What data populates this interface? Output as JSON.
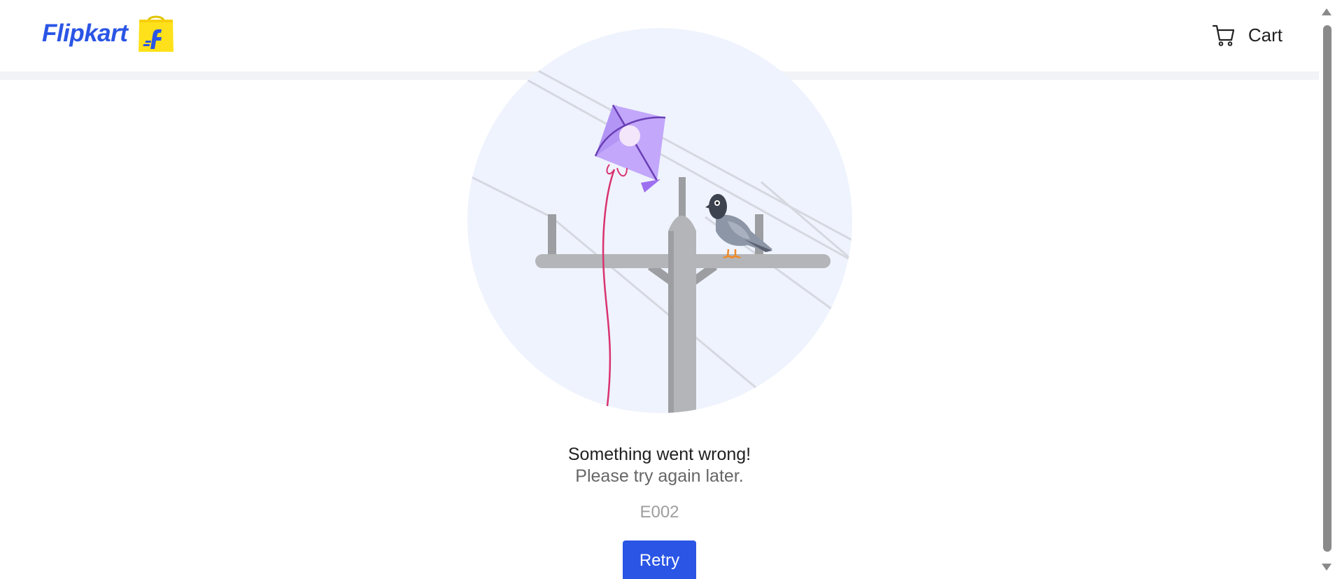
{
  "header": {
    "logo_text": "Flipkart",
    "cart_label": "Cart"
  },
  "icons": {
    "logo": "flipkart-bag-icon",
    "cart": "shopping-cart-icon"
  },
  "error": {
    "title": "Something went wrong!",
    "subtitle": "Please try again later.",
    "code": "E002",
    "retry_label": "Retry"
  },
  "colors": {
    "brand_blue": "#2a55e5",
    "logo_yellow": "#ffe11b",
    "illustration_bg": "#eff3fd",
    "kite": "#b295f5",
    "kite_string": "#d9336f",
    "pole": "#b4b5b8"
  }
}
